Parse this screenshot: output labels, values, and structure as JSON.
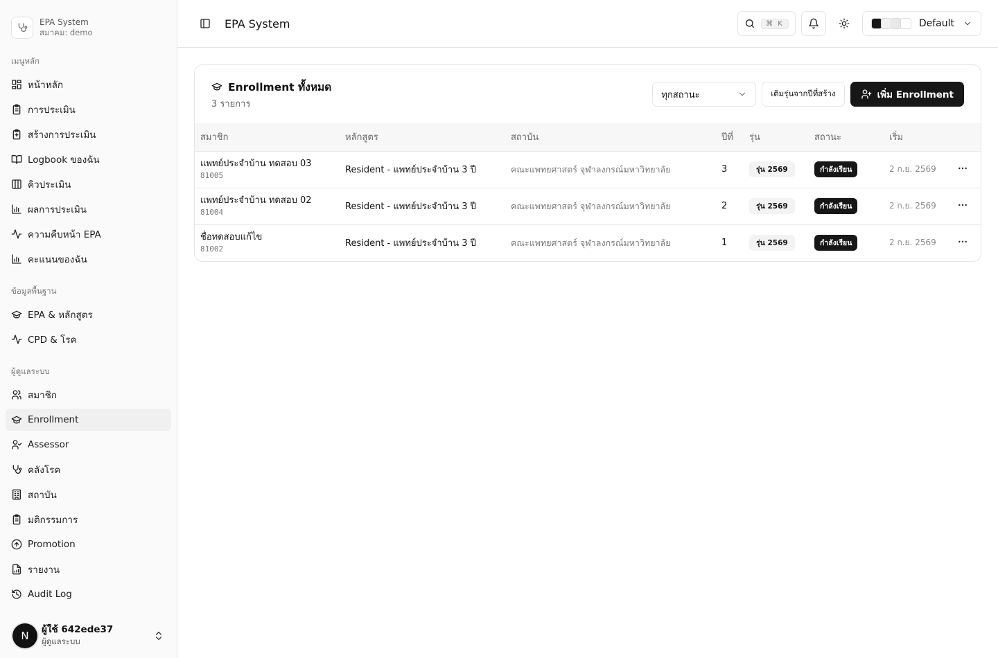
{
  "brand": {
    "name": "EPA System",
    "org": "สมาคม: demo"
  },
  "sidebar": {
    "groups": [
      {
        "label": "เมนูหลัก",
        "items": [
          {
            "label": "หน้าหลัก",
            "icon": "dashboard-icon"
          },
          {
            "label": "การประเมิน",
            "icon": "clipboard-icon"
          },
          {
            "label": "สร้างการประเมิน",
            "icon": "clipboard-plus-icon"
          },
          {
            "label": "Logbook ของฉัน",
            "icon": "book-open-icon"
          },
          {
            "label": "คิวประเมิน",
            "icon": "columns-icon"
          },
          {
            "label": "ผลการประเมิน",
            "icon": "bar-chart-icon"
          },
          {
            "label": "ความคืบหน้า EPA",
            "icon": "activity-icon"
          },
          {
            "label": "คะแนนของฉัน",
            "icon": "bar-chart-icon"
          }
        ]
      },
      {
        "label": "ข้อมูลพื้นฐาน",
        "items": [
          {
            "label": "EPA & หลักสูตร",
            "icon": "graduation-cap-icon"
          },
          {
            "label": "CPD & โรค",
            "icon": "activity-icon"
          }
        ]
      },
      {
        "label": "ผู้ดูแลระบบ",
        "items": [
          {
            "label": "สมาชิก",
            "icon": "users-icon"
          },
          {
            "label": "Enrollment",
            "icon": "graduation-cap-icon",
            "active": true
          },
          {
            "label": "Assessor",
            "icon": "user-check-icon"
          },
          {
            "label": "คลังโรค",
            "icon": "stethoscope-icon"
          },
          {
            "label": "สถาบัน",
            "icon": "building-icon"
          },
          {
            "label": "มติกรรมการ",
            "icon": "clipboard-icon"
          },
          {
            "label": "Promotion",
            "icon": "arrow-up-circle-icon"
          },
          {
            "label": "รายงาน",
            "icon": "file-chart-icon"
          },
          {
            "label": "Audit Log",
            "icon": "history-icon"
          }
        ]
      }
    ]
  },
  "user": {
    "initial": "N",
    "name": "ผู้ใช้ 642ede37",
    "role": "ผู้ดูแลระบบ"
  },
  "topbar": {
    "title": "EPA System",
    "kbd": "⌘ K",
    "theme_label": "Default"
  },
  "theme_swatches": [
    "#171717",
    "#f2f2f2",
    "#e8e8e8",
    "#ffffff"
  ],
  "card": {
    "title": "Enrollment ทั้งหมด",
    "subtitle": "3 รายการ",
    "status_filter": "ทุกสถานะ",
    "fill_button": "เติมรุ่นจากปีที่สร้าง",
    "add_button": "เพิ่ม Enrollment"
  },
  "table": {
    "columns": [
      "สมาชิก",
      "หลักสูตร",
      "สถาบัน",
      "ปีที่",
      "รุ่น",
      "สถานะ",
      "เริ่ม",
      ""
    ],
    "rows": [
      {
        "name": "แพทย์ประจำบ้าน ทดสอบ 03",
        "id": "81005",
        "program": "Resident - แพทย์ประจำบ้าน 3 ปี",
        "institution": "คณะแพทยศาสตร์ จุฬาลงกรณ์มหาวิทยาลัย",
        "year": "3",
        "cohort": "รุ่น 2569",
        "status": "กำลังเรียน",
        "start": "2 ก.ย. 2569"
      },
      {
        "name": "แพทย์ประจำบ้าน ทดสอบ 02",
        "id": "81004",
        "program": "Resident - แพทย์ประจำบ้าน 3 ปี",
        "institution": "คณะแพทยศาสตร์ จุฬาลงกรณ์มหาวิทยาลัย",
        "year": "2",
        "cohort": "รุ่น 2569",
        "status": "กำลังเรียน",
        "start": "2 ก.ย. 2569"
      },
      {
        "name": "ชื่อทดสอบแก้ไข",
        "id": "81002",
        "program": "Resident - แพทย์ประจำบ้าน 3 ปี",
        "institution": "คณะแพทยศาสตร์ จุฬาลงกรณ์มหาวิทยาลัย",
        "year": "1",
        "cohort": "รุ่น 2569",
        "status": "กำลังเรียน",
        "start": "2 ก.ย. 2569"
      }
    ]
  }
}
